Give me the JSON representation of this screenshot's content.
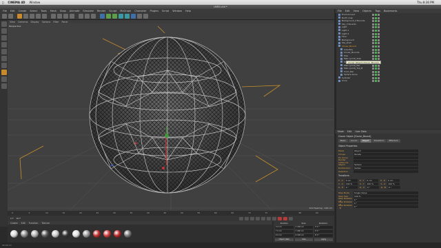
{
  "mac_menu": {
    "app": "CINEMA 4D",
    "items": [
      "Window"
    ],
    "right": [
      "Thu 8:36 PM"
    ]
  },
  "window_title": "LBR5.c4d *",
  "c4d_menu": [
    "File",
    "Edit",
    "Create",
    "Select",
    "Tools",
    "Mesh",
    "Snap",
    "Animate",
    "Simulate",
    "Render",
    "Sculpt",
    "MoGraph",
    "Character",
    "Plugins",
    "Script",
    "Window",
    "Help"
  ],
  "viewport": {
    "menu": [
      "View",
      "Cameras",
      "Display",
      "Options",
      "Filter",
      "Panel"
    ],
    "label": "Perspective",
    "grid_info": "Grid Spacing : 100 cm"
  },
  "objects_manager": {
    "menu": [
      "File",
      "Edit",
      "View",
      "Objects",
      "Tags",
      "Bookmarks"
    ],
    "items": [
      {
        "name": "Environment",
        "selected": false
      },
      {
        "name": "North map",
        "selected": false
      },
      {
        "name": "Background_3 Bounds",
        "selected": false
      },
      {
        "name": "Sky_3 Bounds",
        "selected": false
      },
      {
        "name": "Light",
        "selected": false
      },
      {
        "name": "Light.1",
        "selected": false
      },
      {
        "name": "Light.2",
        "selected": false
      },
      {
        "name": "Floor",
        "selected": false
      },
      {
        "name": "Background",
        "selected": false
      },
      {
        "name": "Sky_shell",
        "selected": false
      },
      {
        "name": "Cloner_Bound",
        "selected": true
      },
      {
        "name": "Low-Poly",
        "selected": false
      },
      {
        "name": "Cloner_Bounds",
        "selected": false
      },
      {
        "name": "Pole",
        "selected": false
      },
      {
        "name": "Main (joint)_Side",
        "selected": false
      },
      {
        "name": "Main (joint)_Outs",
        "selected": false
      },
      {
        "name": "Main (joint)_Bar",
        "selected": false
      },
      {
        "name": "Main (joint)_Top_B",
        "selected": false
      },
      {
        "name": "Color_Bar",
        "selected": false
      },
      {
        "name": "Sphere-Grow",
        "selected": false
      },
      {
        "name": "Cylinder",
        "selected": false
      },
      {
        "name": "Cone",
        "selected": false
      }
    ],
    "tooltip": "Cloner Object [Cloner_Bound]"
  },
  "attributes_manager": {
    "menu": [
      "Mode",
      "Edit",
      "User Data"
    ],
    "title": "Cloner Object [Cloner_Bound]",
    "tabs": [
      "Basic",
      "Coord.",
      "Object",
      "Transform",
      "Effectors"
    ],
    "active_tab": "Object",
    "section": "Object Properties",
    "rows": [
      {
        "label": "Mode",
        "value": "Object"
      },
      {
        "label": "Clones",
        "value": "Iterate"
      },
      {
        "label": "Fix Clone",
        "value": ""
      },
      {
        "label": "Render Instances",
        "value": ""
      },
      {
        "label": "Object",
        "value": "Sphere"
      },
      {
        "label": "Distribution",
        "value": "Vertex"
      },
      {
        "label": "Selection",
        "value": ""
      }
    ],
    "transform_section": "Transform",
    "p": [
      "0 cm",
      "0 cm",
      "0 cm"
    ],
    "s": [
      "100 %",
      "100 %",
      "100 %"
    ],
    "r": [
      "0 °",
      "0 °",
      "0 °"
    ],
    "extra": [
      {
        "label": "Step Mode",
        "value": "Single Value"
      },
      {
        "label": "Step Size",
        "value": "100 %"
      },
      {
        "label": "Step Rotation . H",
        "value": "0 °"
      },
      {
        "label": "Step Rotation . P",
        "value": "0 °"
      },
      {
        "label": "Step Rotation . B",
        "value": "0 °"
      }
    ]
  },
  "timeline": {
    "ticks": [
      "0",
      "5",
      "10",
      "15",
      "20",
      "25",
      "30",
      "35",
      "40",
      "45",
      "50",
      "55",
      "60",
      "65",
      "70",
      "75",
      "80",
      "85",
      "90"
    ],
    "current": "0 F",
    "end": "90 F"
  },
  "materials": {
    "menu": [
      "Create",
      "Edit",
      "Function",
      "Texture"
    ],
    "colors": [
      "#d9d9d9",
      "#8a8a8a",
      "#b0b0b0",
      "#5f5f5f",
      "#c9c9c9",
      "#3a3a3a",
      "#e0e0e0",
      "#9a9a9a",
      "#c23030",
      "#d04040",
      "#b92a2a",
      "#7a7a7a"
    ]
  },
  "coordinates": {
    "headers": [
      "Position",
      "Size",
      "Rotation"
    ],
    "rows": [
      [
        "X  0 cm",
        "X  200 cm",
        "H  0 °"
      ],
      [
        "Y  0 cm",
        "Y  200 cm",
        "P  0 °"
      ],
      [
        "Z  0 cm",
        "Z  200 cm",
        "B  0 °"
      ]
    ],
    "mode": "Object (Rel)",
    "size_mode": "Size",
    "apply": "Apply"
  },
  "status": "00:00:13"
}
